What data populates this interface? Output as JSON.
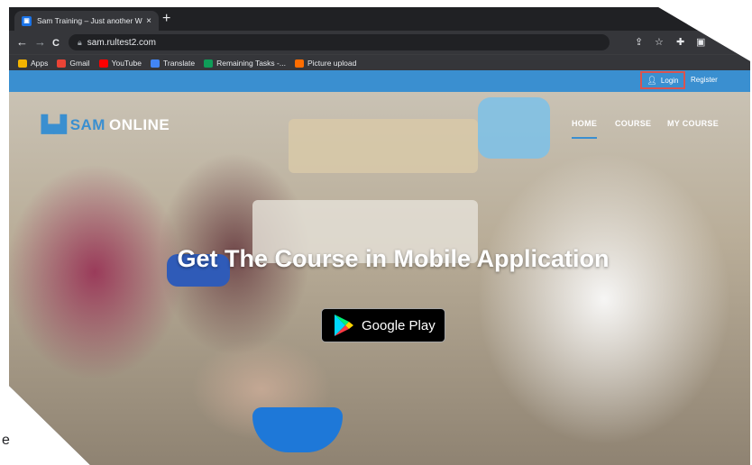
{
  "browser": {
    "tab_title": "Sam Training – Just another W",
    "tab_close": "×",
    "new_tab": "+",
    "url": "sam.rultest2.com",
    "back": "←",
    "forward": "→",
    "reload": "C"
  },
  "bookmarks": [
    {
      "label": "Apps",
      "color": "#f4b400"
    },
    {
      "label": "Gmail",
      "color": "#ea4335"
    },
    {
      "label": "YouTube",
      "color": "#ff0000"
    },
    {
      "label": "Translate",
      "color": "#4285f4"
    },
    {
      "label": "Remaining Tasks -...",
      "color": "#0f9d58"
    },
    {
      "label": "Picture upload",
      "color": "#ff6d00"
    }
  ],
  "site": {
    "login_label": "Login",
    "register_label": "Register",
    "logo_sam": "SAM",
    "logo_online": "ONLINE",
    "menu": [
      "HOME",
      "COURSE",
      "MY COURSE"
    ],
    "headline": "Get The Course in Mobile Application",
    "store_button": "Google Play"
  },
  "corner_text": "e",
  "colors": {
    "accent": "#3a8fd0",
    "login_highlight": "#d9534f"
  }
}
